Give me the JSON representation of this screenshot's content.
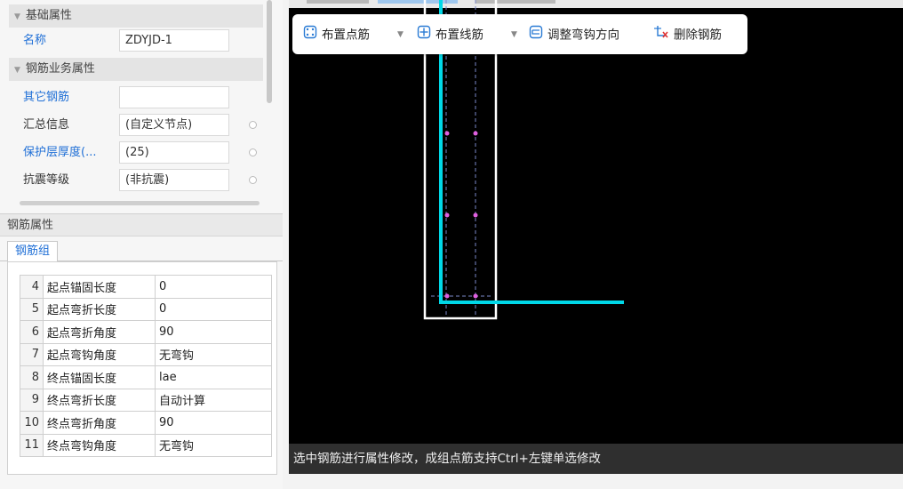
{
  "basic_props": {
    "header": "基础属性",
    "name_label": "名称",
    "name_value": "ZDYJD-1"
  },
  "business_props": {
    "header": "钢筋业务属性",
    "rows": [
      {
        "label": "其它钢筋",
        "value": ""
      },
      {
        "label": "汇总信息",
        "value": "(自定义节点)"
      },
      {
        "label": "保护层厚度(...",
        "value": "(25)"
      },
      {
        "label": "抗震等级",
        "value": "(非抗震)"
      }
    ]
  },
  "rebar_attr": {
    "header": "钢筋属性",
    "tab": "钢筋组",
    "rows": [
      {
        "num": "4",
        "name": "起点锚固长度",
        "value": "0"
      },
      {
        "num": "5",
        "name": "起点弯折长度",
        "value": "0"
      },
      {
        "num": "6",
        "name": "起点弯折角度",
        "value": "90"
      },
      {
        "num": "7",
        "name": "起点弯钩角度",
        "value": "无弯钩"
      },
      {
        "num": "8",
        "name": "终点锚固长度",
        "value": "lae"
      },
      {
        "num": "9",
        "name": "终点弯折长度",
        "value": "自动计算"
      },
      {
        "num": "10",
        "name": "终点弯折角度",
        "value": "90"
      },
      {
        "num": "11",
        "name": "终点弯钩角度",
        "value": "无弯钩"
      }
    ]
  },
  "toolbar": {
    "point_rebar": "布置点筋",
    "line_rebar": "布置线筋",
    "adjust_hook": "调整弯钩方向",
    "delete_rebar": "删除钢筋"
  },
  "status": {
    "message": "选中钢筋进行属性修改，成组点筋支持Ctrl+左键单选修改"
  },
  "colors": {
    "rebar": "#00d8e8",
    "outline": "#ffffff",
    "dashed": "#7a88c8",
    "point": "#e060e0",
    "link_blue": "#1f6fd6"
  }
}
